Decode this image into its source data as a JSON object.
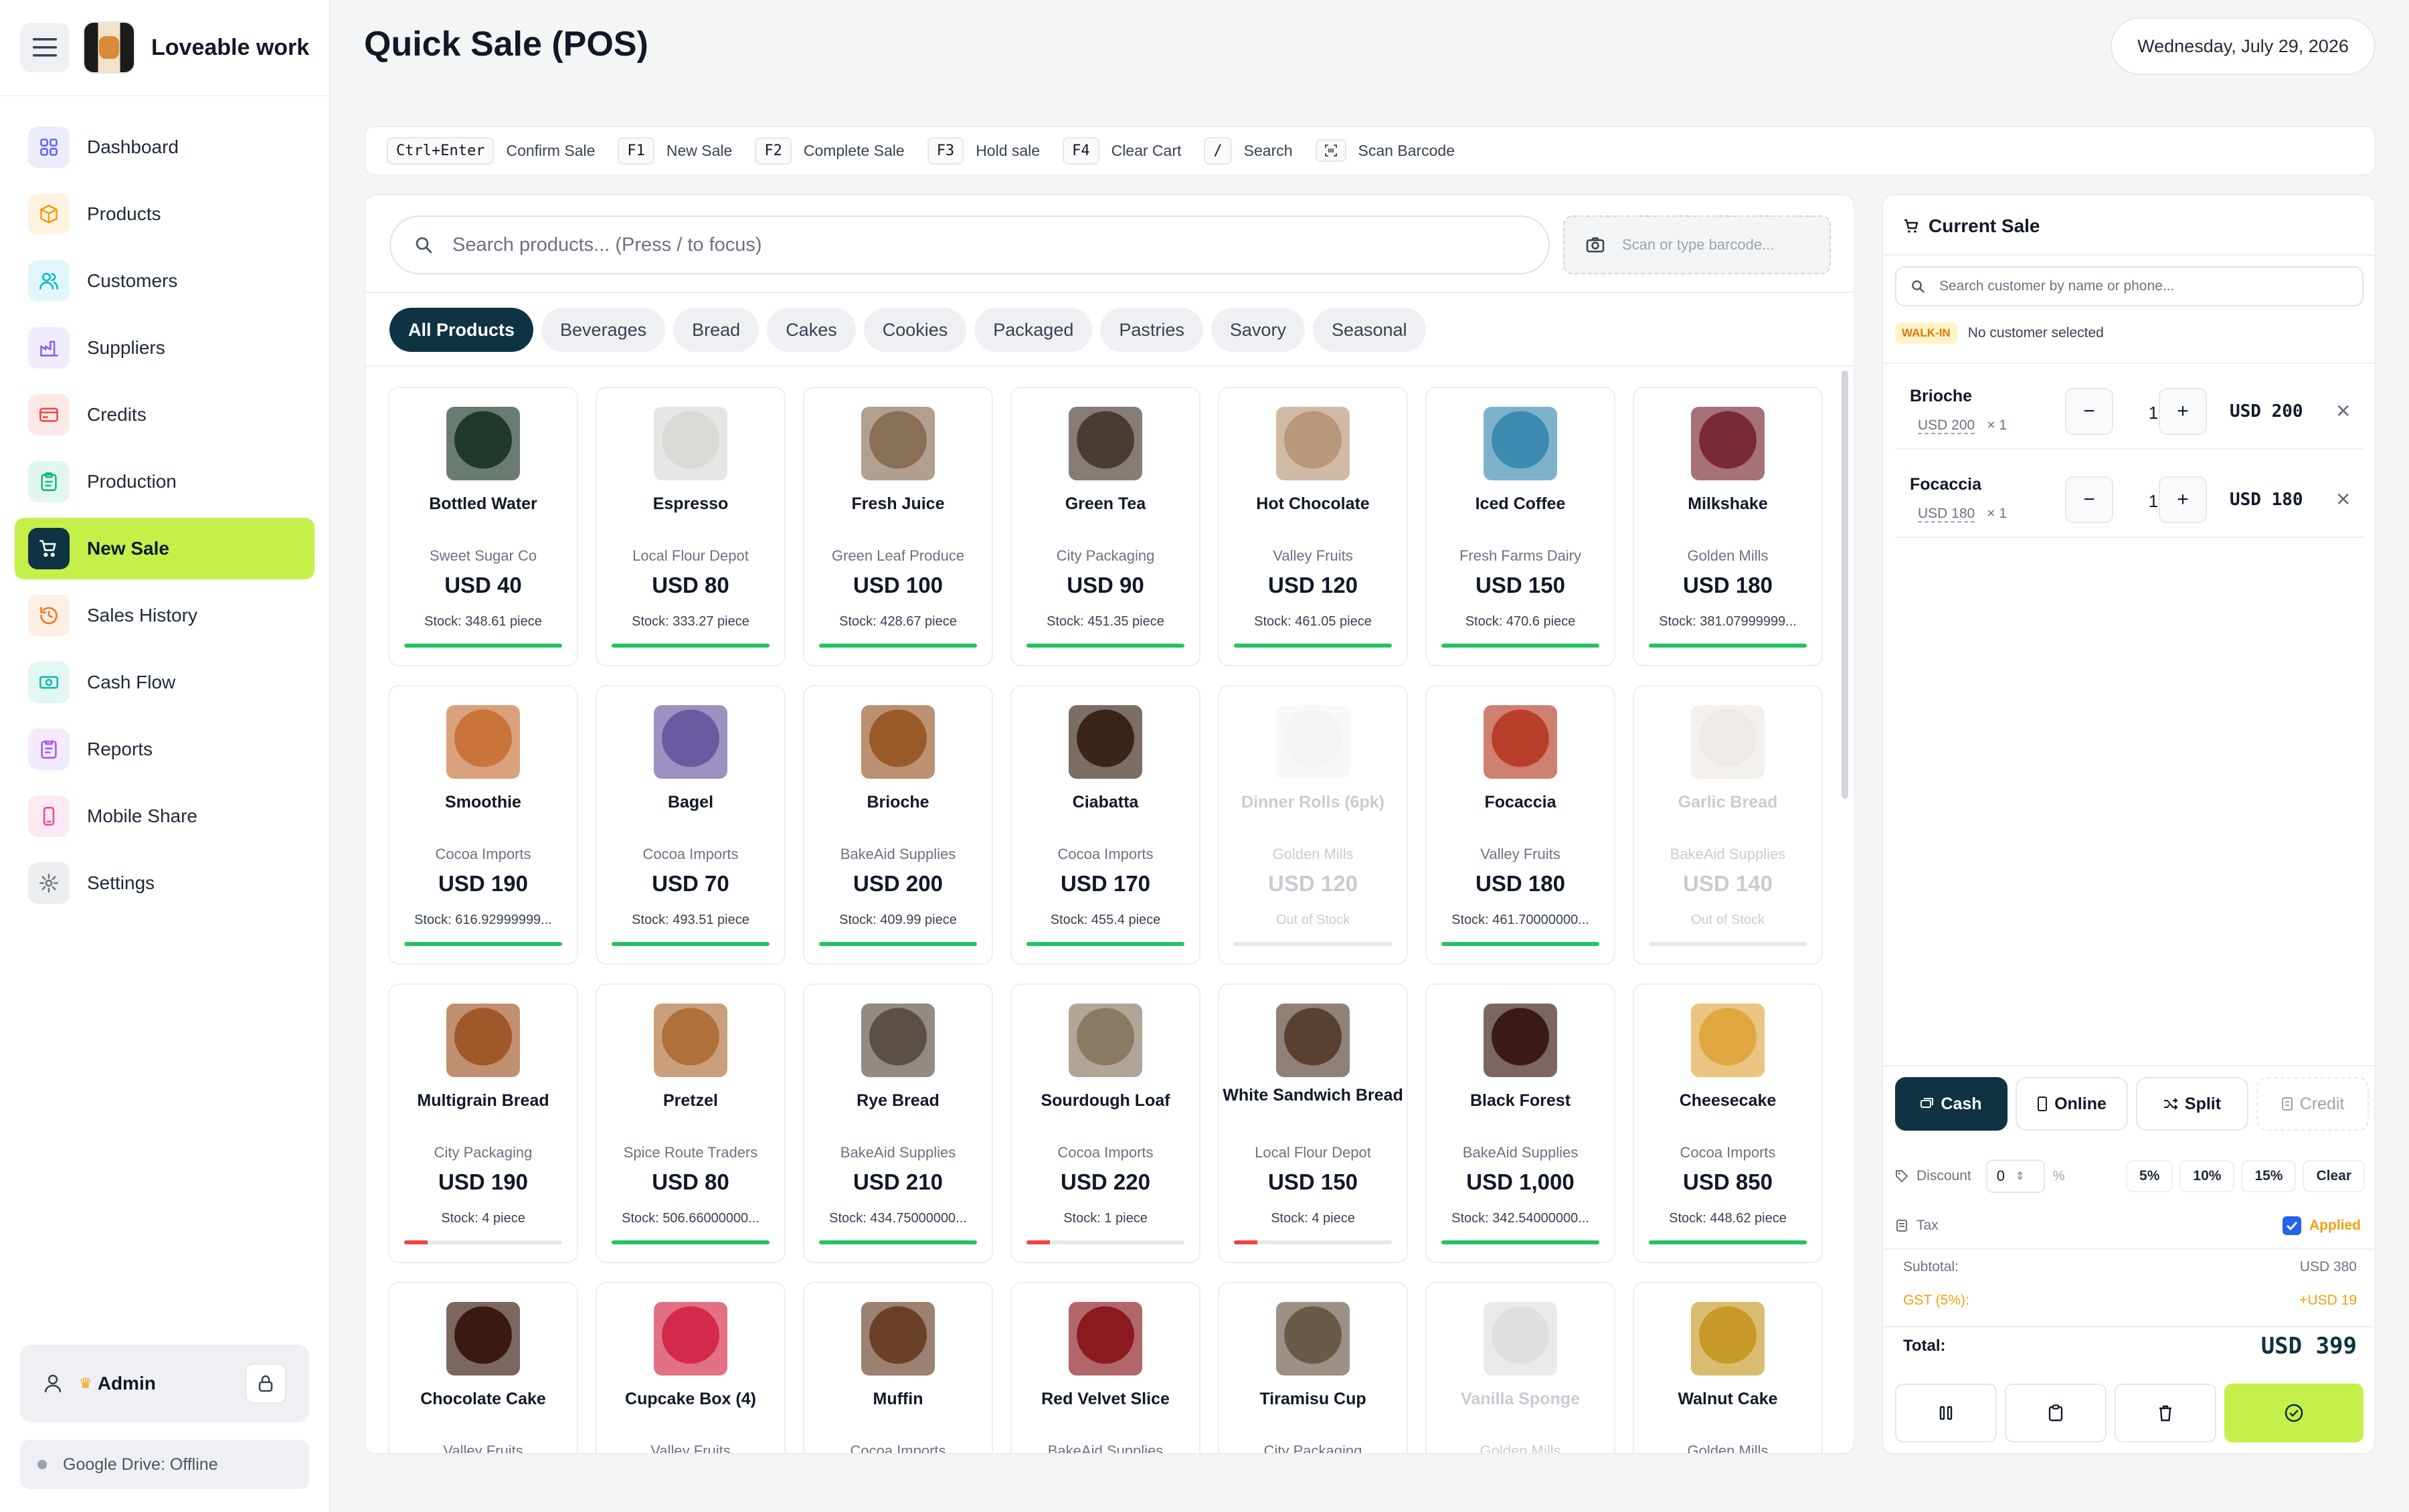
{
  "app": {
    "name": "Loveable work"
  },
  "header": {
    "title": "Quick Sale (POS)",
    "date": "Wednesday, July 29, 2026"
  },
  "sidebar": {
    "items": [
      {
        "label": "Dashboard",
        "icon": "dashboard-icon",
        "color": "#6366f1"
      },
      {
        "label": "Products",
        "icon": "box-icon",
        "color": "#f59e0b"
      },
      {
        "label": "Customers",
        "icon": "users-icon",
        "color": "#06b6d4"
      },
      {
        "label": "Suppliers",
        "icon": "factory-icon",
        "color": "#8b5cf6"
      },
      {
        "label": "Credits",
        "icon": "credit-card-icon",
        "color": "#ef4444"
      },
      {
        "label": "Production",
        "icon": "clipboard-icon",
        "color": "#10b981"
      },
      {
        "label": "New Sale",
        "icon": "cart-icon",
        "color": "#0f3342",
        "active": true
      },
      {
        "label": "Sales History",
        "icon": "history-icon",
        "color": "#f97316"
      },
      {
        "label": "Cash Flow",
        "icon": "cash-icon",
        "color": "#14b8a6"
      },
      {
        "label": "Reports",
        "icon": "report-icon",
        "color": "#a855f7"
      },
      {
        "label": "Mobile Share",
        "icon": "phone-icon",
        "color": "#ec4899"
      },
      {
        "label": "Settings",
        "icon": "gear-icon",
        "color": "#6b7280"
      }
    ],
    "user": "Admin",
    "drive_status": "Google Drive: Offline"
  },
  "shortcuts": [
    {
      "key": "Ctrl+Enter",
      "label": "Confirm Sale"
    },
    {
      "key": "F1",
      "label": "New Sale"
    },
    {
      "key": "F2",
      "label": "Complete Sale"
    },
    {
      "key": "F3",
      "label": "Hold sale"
    },
    {
      "key": "F4",
      "label": "Clear Cart"
    },
    {
      "key": "/",
      "label": "Search"
    },
    {
      "key": "",
      "label": "Scan Barcode"
    }
  ],
  "search": {
    "placeholder": "Search products... (Press / to focus)",
    "barcode_placeholder": "Scan or type barcode..."
  },
  "categories": [
    "All Products",
    "Beverages",
    "Bread",
    "Cakes",
    "Cookies",
    "Packaged",
    "Pastries",
    "Savory",
    "Seasonal"
  ],
  "products": [
    {
      "name": "Bottled Water",
      "supplier": "Sweet Sugar Co",
      "price": "USD 40",
      "stock": "Stock: 348.61 piece",
      "level": 1.0,
      "color": "#1f3a2a"
    },
    {
      "name": "Espresso",
      "supplier": "Local Flour Depot",
      "price": "USD 80",
      "stock": "Stock: 333.27 piece",
      "level": 1.0,
      "color": "#d9d9d6"
    },
    {
      "name": "Fresh Juice",
      "supplier": "Green Leaf Produce",
      "price": "USD 100",
      "stock": "Stock: 428.67 piece",
      "level": 1.0,
      "color": "#8a6f57"
    },
    {
      "name": "Green Tea",
      "supplier": "City Packaging",
      "price": "USD 90",
      "stock": "Stock: 451.35 piece",
      "level": 1.0,
      "color": "#4a3b35"
    },
    {
      "name": "Hot Chocolate",
      "supplier": "Valley Fruits",
      "price": "USD 120",
      "stock": "Stock: 461.05 piece",
      "level": 1.0,
      "color": "#b8987a"
    },
    {
      "name": "Iced Coffee",
      "supplier": "Fresh Farms Dairy",
      "price": "USD 150",
      "stock": "Stock: 470.6 piece",
      "level": 1.0,
      "color": "#3d8bb0"
    },
    {
      "name": "Milkshake",
      "supplier": "Golden Mills",
      "price": "USD 180",
      "stock": "Stock: 381.07999999...",
      "level": 1.0,
      "color": "#7a2a35"
    },
    {
      "name": "Smoothie",
      "supplier": "Cocoa Imports",
      "price": "USD 190",
      "stock": "Stock: 616.92999999...",
      "level": 1.0,
      "color": "#c8743a"
    },
    {
      "name": "Bagel",
      "supplier": "Cocoa Imports",
      "price": "USD 70",
      "stock": "Stock: 493.51 piece",
      "level": 1.0,
      "color": "#6a5aa0"
    },
    {
      "name": "Brioche",
      "supplier": "BakeAid Supplies",
      "price": "USD 200",
      "stock": "Stock: 409.99 piece",
      "level": 1.0,
      "color": "#9a5a2a"
    },
    {
      "name": "Ciabatta",
      "supplier": "Cocoa Imports",
      "price": "USD 170",
      "stock": "Stock: 455.4 piece",
      "level": 1.0,
      "color": "#3a2418"
    },
    {
      "name": "Dinner Rolls (6pk)",
      "supplier": "Golden Mills",
      "price": "USD 120",
      "stock": "Out of Stock",
      "level": 0,
      "oos": true,
      "color": "#e6e6e6"
    },
    {
      "name": "Focaccia",
      "supplier": "Valley Fruits",
      "price": "USD 180",
      "stock": "Stock: 461.70000000...",
      "level": 1.0,
      "color": "#b8402a"
    },
    {
      "name": "Garlic Bread",
      "supplier": "BakeAid Supplies",
      "price": "USD 140",
      "stock": "Out of Stock",
      "level": 0,
      "oos": true,
      "color": "#d8cfc4"
    },
    {
      "name": "Multigrain Bread",
      "supplier": "City Packaging",
      "price": "USD 190",
      "stock": "Stock: 4 piece",
      "level": 0.15,
      "low": true,
      "color": "#a0582a"
    },
    {
      "name": "Pretzel",
      "supplier": "Spice Route Traders",
      "price": "USD 80",
      "stock": "Stock: 506.66000000...",
      "level": 1.0,
      "color": "#b0703a"
    },
    {
      "name": "Rye Bread",
      "supplier": "BakeAid Supplies",
      "price": "USD 210",
      "stock": "Stock: 434.75000000...",
      "level": 1.0,
      "color": "#5a5048"
    },
    {
      "name": "Sourdough Loaf",
      "supplier": "Cocoa Imports",
      "price": "USD 220",
      "stock": "Stock: 1 piece",
      "level": 0.15,
      "low": true,
      "color": "#8a7a62"
    },
    {
      "name": "White Sandwich Bread",
      "supplier": "Local Flour Depot",
      "price": "USD 150",
      "stock": "Stock: 4 piece",
      "level": 0.15,
      "low": true,
      "color": "#5a4030"
    },
    {
      "name": "Black Forest",
      "supplier": "BakeAid Supplies",
      "price": "USD 1,000",
      "stock": "Stock: 342.54000000...",
      "level": 1.0,
      "color": "#3a1a16"
    },
    {
      "name": "Cheesecake",
      "supplier": "Cocoa Imports",
      "price": "USD 850",
      "stock": "Stock: 448.62 piece",
      "level": 1.0,
      "color": "#e0a640"
    },
    {
      "name": "Chocolate Cake",
      "supplier": "Valley Fruits",
      "price": "",
      "stock": "",
      "level": 0,
      "color": "#3a1a10"
    },
    {
      "name": "Cupcake Box (4)",
      "supplier": "Valley Fruits",
      "price": "",
      "stock": "",
      "level": 0,
      "color": "#d42a4a"
    },
    {
      "name": "Muffin",
      "supplier": "Cocoa Imports",
      "price": "",
      "stock": "",
      "level": 0,
      "color": "#6a4028"
    },
    {
      "name": "Red Velvet Slice",
      "supplier": "BakeAid Supplies",
      "price": "",
      "stock": "",
      "level": 0,
      "color": "#8a1a20"
    },
    {
      "name": "Tiramisu Cup",
      "supplier": "City Packaging",
      "price": "",
      "stock": "",
      "level": 0,
      "color": "#6a5a48"
    },
    {
      "name": "Vanilla Sponge",
      "supplier": "Golden Mills",
      "price": "",
      "stock": "",
      "level": 0,
      "oos": true,
      "color": "#b8b8b8"
    },
    {
      "name": "Walnut Cake",
      "supplier": "Golden Mills",
      "price": "",
      "stock": "",
      "level": 0,
      "color": "#c89a2a"
    }
  ],
  "cart": {
    "title": "Current Sale",
    "customer_placeholder": "Search customer by name or phone...",
    "walkin_badge": "WALK-IN",
    "no_customer": "No customer selected",
    "lines": [
      {
        "name": "Brioche",
        "unit": "USD 200",
        "mult": "× 1",
        "qty": "1",
        "total": "USD 200"
      },
      {
        "name": "Focaccia",
        "unit": "USD 180",
        "mult": "× 1",
        "qty": "1",
        "total": "USD 180"
      }
    ],
    "payment_methods": [
      "Cash",
      "Online",
      "Split",
      "Credit"
    ],
    "discount_label": "Discount",
    "discount_value": "0",
    "discount_unit": "%",
    "discount_presets": [
      "5%",
      "10%",
      "15%",
      "Clear"
    ],
    "tax_label": "Tax",
    "tax_applied": "Applied",
    "subtotal_label": "Subtotal:",
    "subtotal": "USD 380",
    "gst_label": "GST (5%):",
    "gst": "+USD 19",
    "total_label": "Total:",
    "total": "USD 399"
  }
}
